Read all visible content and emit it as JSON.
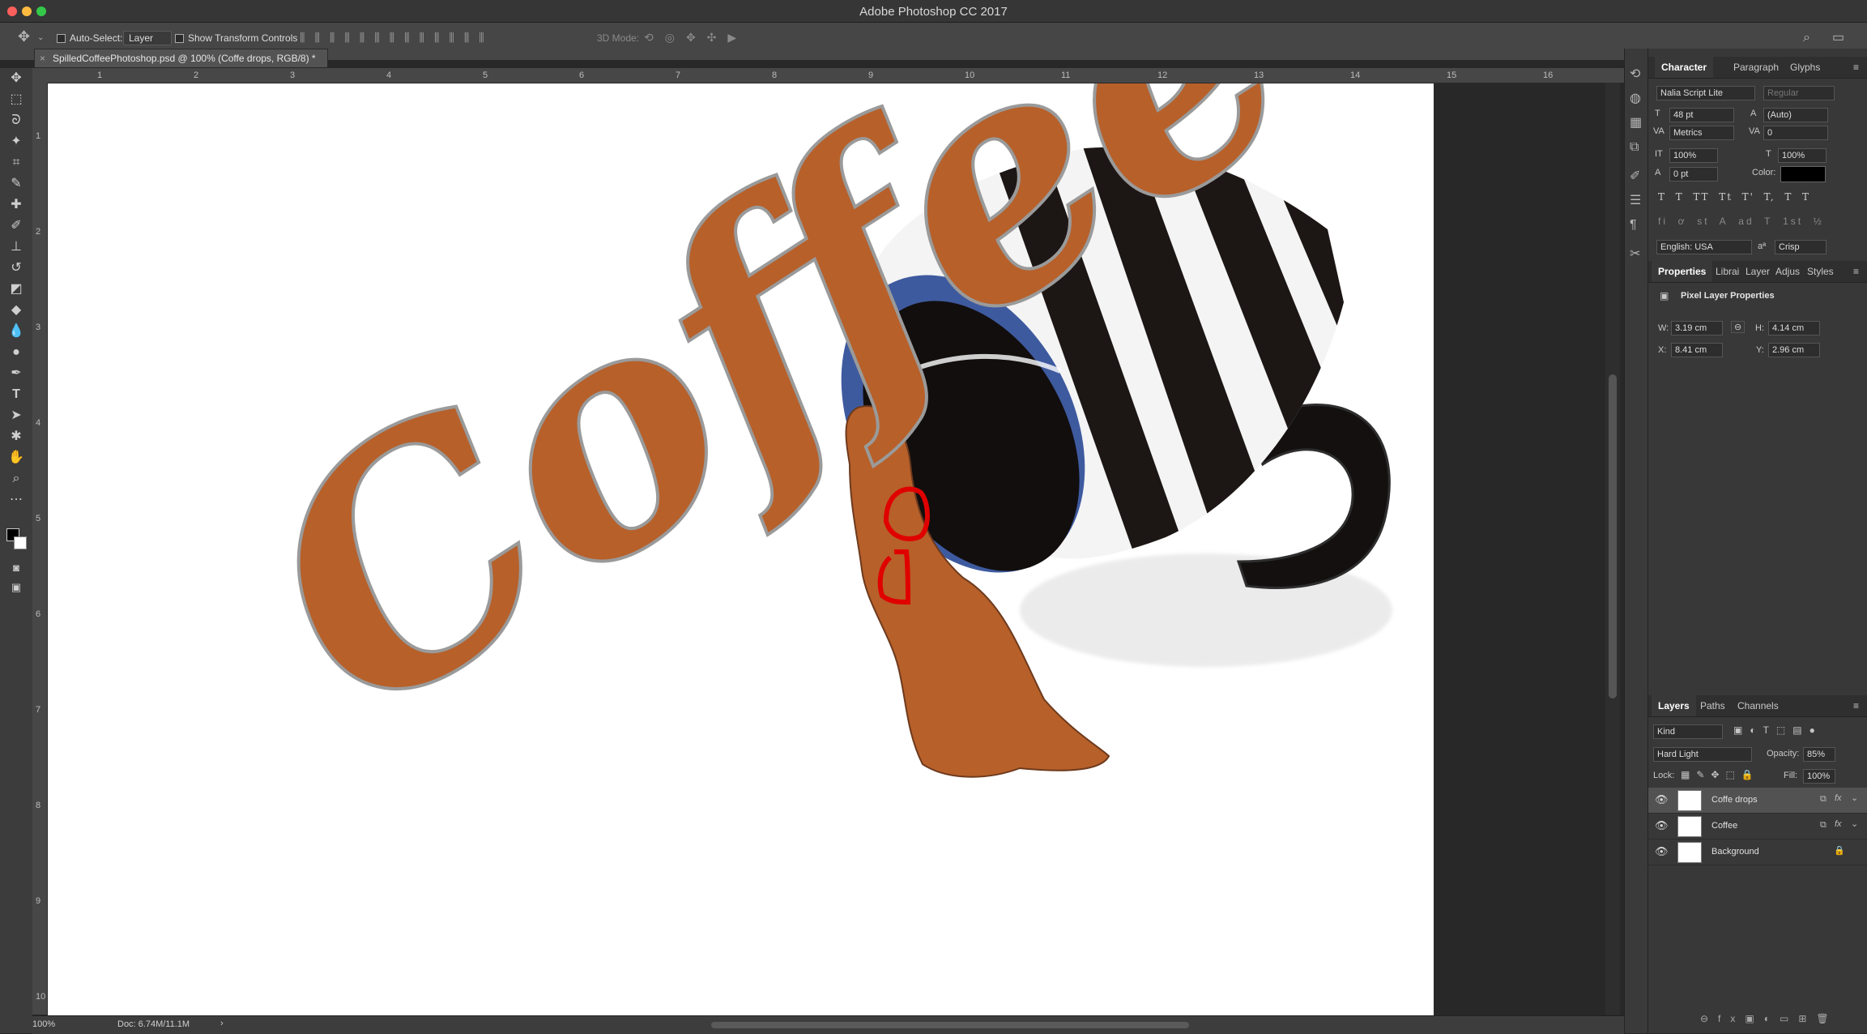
{
  "app_title": "Adobe Photoshop CC 2017",
  "window_controls": {
    "close_color": "#fc605c",
    "min_color": "#fdbc40",
    "max_color": "#34c84a"
  },
  "options_bar": {
    "auto_select_label": "Auto-Select:",
    "auto_select_value": "Layer",
    "transform_controls_label": "Show Transform Controls",
    "mode_3d_label": "3D Mode:"
  },
  "document_tab": {
    "title": "SpilledCoffeePhotoshop.psd @ 100% (Coffe drops, RGB/8) *"
  },
  "ruler": {
    "h_ticks": [
      "1",
      "2",
      "3",
      "4",
      "5",
      "6",
      "7",
      "8",
      "9",
      "10",
      "11",
      "12",
      "13",
      "14",
      "15",
      "16"
    ],
    "v_ticks": [
      "1",
      "2",
      "3",
      "4",
      "5",
      "6",
      "7",
      "8",
      "9",
      "10"
    ]
  },
  "canvas": {
    "text": "Coffee",
    "text_color": "#b7602a",
    "mug_stripe_dark": "#1c1615",
    "mug_inner": "#3e5a9f",
    "annotation_color": "#e00000"
  },
  "status_bar": {
    "zoom": "100%",
    "doc_info": "Doc: 6.74M/11.1M"
  },
  "character_panel": {
    "tabs": [
      "Character",
      "Paragraph",
      "Glyphs"
    ],
    "font_family": "Nalia Script Lite",
    "font_style": "Regular",
    "font_size": "48 pt",
    "leading": "(Auto)",
    "kerning": "Metrics",
    "tracking": "0",
    "vertical_scale": "100%",
    "horizontal_scale": "100%",
    "baseline_shift": "0 pt",
    "color_label": "Color:",
    "color_value": "#000000",
    "type_buttons": [
      "T",
      "T",
      "TT",
      "Tt",
      "T'",
      "T,",
      "T",
      "T"
    ],
    "opentype_buttons": [
      "fi",
      "ơ",
      "st",
      "A",
      "ad",
      "T",
      "1st",
      "½"
    ],
    "language": "English: USA",
    "aa_label": "aª",
    "anti_alias": "Crisp"
  },
  "properties_panel": {
    "tabs": [
      "Properties",
      "Librai",
      "Layer",
      "Adjus",
      "Styles"
    ],
    "heading": "Pixel Layer Properties",
    "w_label": "W:",
    "w_value": "3.19 cm",
    "h_label": "H:",
    "h_value": "4.14 cm",
    "x_label": "X:",
    "x_value": "8.41 cm",
    "y_label": "Y:",
    "y_value": "2.96 cm"
  },
  "layers_panel": {
    "tabs": [
      "Layers",
      "Paths",
      "Channels"
    ],
    "filter_kind": "Kind",
    "blend_mode": "Hard Light",
    "opacity_label": "Opacity:",
    "opacity_value": "85%",
    "lock_label": "Lock:",
    "fill_label": "Fill:",
    "fill_value": "100%",
    "layers": [
      {
        "name": "Coffe drops",
        "selected": true,
        "fx": true,
        "locked": false
      },
      {
        "name": "Coffee",
        "selected": false,
        "fx": true,
        "locked": false
      },
      {
        "name": "Background",
        "selected": false,
        "fx": false,
        "locked": true
      }
    ]
  }
}
